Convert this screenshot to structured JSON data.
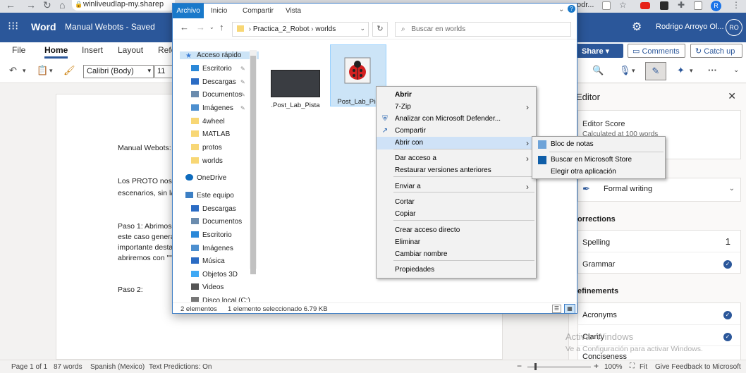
{
  "browser": {
    "url_left": "winliveudlap-my.sharep",
    "url_right": "odr...",
    "profile": "R"
  },
  "word": {
    "app_name": "Word",
    "doc_title": "Manual Webots - Saved",
    "user_name": "Rodrigo Arroyo Ol...",
    "user_initials": "RO",
    "tabs": [
      "File",
      "Home",
      "Insert",
      "Layout",
      "Refe"
    ],
    "share_label": "Share",
    "comments_label": "Comments",
    "catchup_label": "Catch up",
    "font_name": "Calibri (Body)",
    "font_size": "11"
  },
  "document": {
    "line1": "Manual Webots:",
    "line2": "Los PROTO nos a",
    "line3": "escenarios, sin la",
    "line4": "Paso 1: Abrimos",
    "line5": "este caso genera",
    "line6": "importante desta",
    "line7": "abriremos con \"\"",
    "line8": "Paso 2:"
  },
  "editor": {
    "title": "Editor",
    "score_title": "Editor Score",
    "score_sub": "Calculated at 100 words",
    "formal": "Formal writing",
    "corrections": "orrections",
    "spelling": "Spelling",
    "spelling_count": "1",
    "grammar": "Grammar",
    "refinements": "efinements",
    "acronyms": "Acronyms",
    "clarity": "Clarity",
    "conciseness": "Conciseness"
  },
  "watermark": {
    "line1": "Activar Windows",
    "line2": "Ve a Configuración para activar Windows."
  },
  "status": {
    "page": "Page 1 of 1",
    "words": "87 words",
    "lang": "Spanish (Mexico)",
    "predictions": "Text Predictions: On",
    "zoom": "100%",
    "fit": "Fit",
    "feedback": "Give Feedback to Microsoft"
  },
  "explorer": {
    "tabs": [
      "Archivo",
      "Inicio",
      "Compartir",
      "Vista"
    ],
    "path": [
      "Practica_2_Robot",
      "worlds"
    ],
    "search_placeholder": "Buscar en worlds",
    "sidebar": [
      {
        "label": "Acceso rápido",
        "icon": "star-icon",
        "pinned": false,
        "color": "#3a7bd5"
      },
      {
        "label": "Escritorio",
        "icon": "desktop-icon",
        "pinned": true,
        "color": "#2b88d8"
      },
      {
        "label": "Descargas",
        "icon": "download-icon",
        "pinned": true,
        "color": "#2b6cc4"
      },
      {
        "label": "Documentos",
        "icon": "documents-icon",
        "pinned": true,
        "color": "#6b8cae"
      },
      {
        "label": "Imágenes",
        "icon": "pictures-icon",
        "pinned": true,
        "color": "#4d8fcf"
      },
      {
        "label": "4wheel",
        "icon": "folder-icon",
        "pinned": false,
        "color": "#f8d775"
      },
      {
        "label": "MATLAB",
        "icon": "folder-icon",
        "pinned": false,
        "color": "#f8d775"
      },
      {
        "label": "protos",
        "icon": "folder-icon",
        "pinned": false,
        "color": "#f8d775"
      },
      {
        "label": "worlds",
        "icon": "folder-icon",
        "pinned": false,
        "color": "#f8d775"
      },
      {
        "label": "OneDrive",
        "icon": "cloud-icon",
        "pinned": false,
        "color": "#0f6cbd"
      },
      {
        "label": "Este equipo",
        "icon": "computer-icon",
        "pinned": false,
        "color": "#3c7fc4"
      },
      {
        "label": "Descargas",
        "icon": "download-icon",
        "pinned": false,
        "color": "#2b6cc4"
      },
      {
        "label": "Documentos",
        "icon": "documents-icon",
        "pinned": false,
        "color": "#6b8cae"
      },
      {
        "label": "Escritorio",
        "icon": "desktop-icon",
        "pinned": false,
        "color": "#2b88d8"
      },
      {
        "label": "Imágenes",
        "icon": "pictures-icon",
        "pinned": false,
        "color": "#4d8fcf"
      },
      {
        "label": "Música",
        "icon": "music-icon",
        "pinned": false,
        "color": "#2b6cc4"
      },
      {
        "label": "Objetos 3D",
        "icon": "cube-icon",
        "pinned": false,
        "color": "#3fa9f5"
      },
      {
        "label": "Videos",
        "icon": "video-icon",
        "pinned": false,
        "color": "#555"
      },
      {
        "label": "Disco local (C:)",
        "icon": "disk-icon",
        "pinned": false,
        "color": "#777"
      }
    ],
    "files": [
      {
        "name": ".Post_Lab_Pista"
      },
      {
        "name": "Post_Lab_Pist"
      }
    ],
    "status_count": "2 elementos",
    "status_selected": "1 elemento seleccionado  6.79 KB"
  },
  "context_menu": [
    {
      "label": "Abrir",
      "bold": true
    },
    {
      "label": "7-Zip",
      "submenu": true
    },
    {
      "label": "Analizar con Microsoft Defender...",
      "icon": "defender-icon"
    },
    {
      "label": "Compartir",
      "icon": "share-icon"
    },
    {
      "label": "Abrir con",
      "submenu": true,
      "highlight": true
    },
    {
      "label": "Dar acceso a",
      "submenu": true
    },
    {
      "label": "Restaurar versiones anteriores"
    },
    {
      "label": "Enviar a",
      "submenu": true
    },
    {
      "label": "Cortar"
    },
    {
      "label": "Copiar"
    },
    {
      "label": "Crear acceso directo"
    },
    {
      "label": "Eliminar"
    },
    {
      "label": "Cambiar nombre"
    },
    {
      "label": "Propiedades"
    }
  ],
  "open_with_menu": [
    {
      "label": "Bloc de notas",
      "icon": "notepad-icon"
    },
    {
      "label": "Buscar en Microsoft Store",
      "icon": "store-icon"
    },
    {
      "label": "Elegir otra aplicación"
    }
  ]
}
